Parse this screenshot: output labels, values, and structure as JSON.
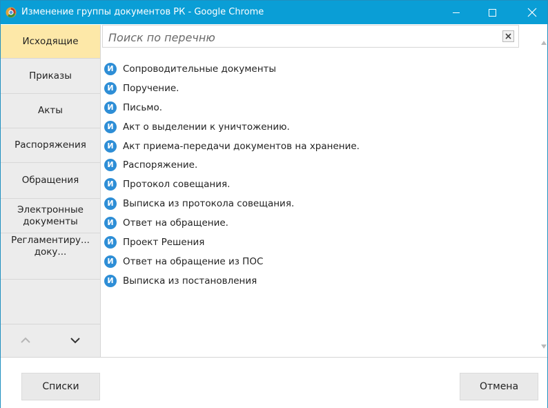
{
  "window": {
    "title": "Изменение группы документов РК - Google Chrome",
    "title_bar_color": "#0a9ed6",
    "icons": {
      "app": "chrome-app-icon",
      "minimize": "minimize-icon",
      "maximize": "maximize-icon",
      "close": "close-icon"
    }
  },
  "sidebar": {
    "items": [
      {
        "label": "Исходящие",
        "active": true
      },
      {
        "label": "Приказы",
        "active": false
      },
      {
        "label": "Акты",
        "active": false
      },
      {
        "label": "Распоряжения",
        "active": false
      },
      {
        "label": "Обращения",
        "active": false
      },
      {
        "label": "Электронные документы",
        "active": false
      },
      {
        "label": "Регламентиру... доку...",
        "active": false
      }
    ],
    "active_color": "#fde8a8",
    "nav": {
      "up_icon": "chevron-up-icon",
      "down_icon": "chevron-down-icon"
    }
  },
  "search": {
    "placeholder": "Поиск по перечню",
    "value": "",
    "clear_icon": "close-icon"
  },
  "list": {
    "badge_letter": "И",
    "badge_color": "#2e8ed6",
    "items": [
      "Сопроводительные документы",
      "Поручение.",
      "Письмо.",
      "Акт о выделении к уничтожению.",
      "Акт приема-передачи документов на хранение.",
      "Распоряжение.",
      "Протокол совещания.",
      "Выписка из протокола совещания.",
      "Ответ на обращение.",
      "Проект Решения",
      "Ответ на обращение из ПОС",
      "Выписка из постановления"
    ]
  },
  "footer": {
    "lists_label": "Списки",
    "cancel_label": "Отмена"
  }
}
